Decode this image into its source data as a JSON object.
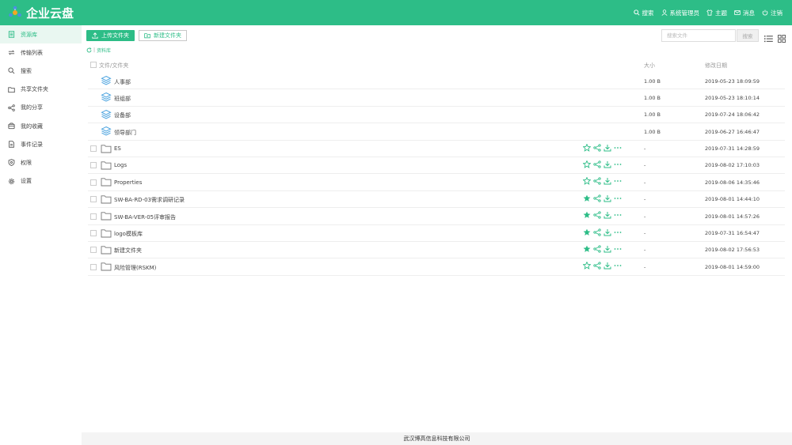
{
  "app": {
    "title": "企业云盘",
    "brand_color": "#2dbd87"
  },
  "topnav": [
    {
      "label": "搜索",
      "icon": "search-icon"
    },
    {
      "label": "系统管理员",
      "icon": "user-icon"
    },
    {
      "label": "主题",
      "icon": "shirt-icon"
    },
    {
      "label": "消息",
      "icon": "mail-icon"
    },
    {
      "label": "注销",
      "icon": "power-icon"
    }
  ],
  "sidebar": {
    "items": [
      {
        "label": "资源库",
        "icon": "library-icon",
        "active": true
      },
      {
        "label": "传输列表",
        "icon": "transfer-icon"
      },
      {
        "label": "搜索",
        "icon": "search-icon"
      },
      {
        "label": "共享文件夹",
        "icon": "folder-icon"
      },
      {
        "label": "我的分享",
        "icon": "share-icon"
      },
      {
        "label": "我的收藏",
        "icon": "collection-icon"
      },
      {
        "label": "事件记录",
        "icon": "document-icon"
      },
      {
        "label": "权限",
        "icon": "shield-icon"
      },
      {
        "label": "设置",
        "icon": "gear-icon"
      }
    ]
  },
  "toolbar": {
    "upload_label": "上传文件夹",
    "new_folder_label": "新建文件夹",
    "search_placeholder": "搜索文件",
    "search_button": "搜索"
  },
  "breadcrumb": "资料库",
  "table": {
    "headers": {
      "name": "文件/文件夹",
      "size": "大小",
      "date": "修改日期"
    },
    "rows": [
      {
        "name": "人事部",
        "type": "library",
        "size": "1.00 B",
        "date": "2019-05-23 18:09:59"
      },
      {
        "name": "班组部",
        "type": "library",
        "size": "1.00 B",
        "date": "2019-05-23 18:10:14"
      },
      {
        "name": "设备部",
        "type": "library",
        "size": "1.00 B",
        "date": "2019-07-24 18:06:42"
      },
      {
        "name": "领导部门",
        "type": "library",
        "size": "1.00 B",
        "date": "2019-06-27 16:46:47"
      },
      {
        "name": "ES",
        "type": "folder",
        "starred": false,
        "size": "-",
        "date": "2019-07-31 14:28:59"
      },
      {
        "name": "Logs",
        "type": "folder",
        "starred": false,
        "size": "-",
        "date": "2019-08-02 17:10:03"
      },
      {
        "name": "Properties",
        "type": "folder",
        "starred": false,
        "size": "-",
        "date": "2019-08-06 14:35:46"
      },
      {
        "name": "SW-BA-RD-03需求调研记录",
        "type": "folder",
        "starred": true,
        "size": "-",
        "date": "2019-08-01 14:44:10"
      },
      {
        "name": "SW-BA-VER-05评审报告",
        "type": "folder",
        "starred": true,
        "size": "-",
        "date": "2019-08-01 14:57:26"
      },
      {
        "name": "logo模板库",
        "type": "folder",
        "starred": true,
        "size": "-",
        "date": "2019-07-31 16:54:47"
      },
      {
        "name": "新建文件夹",
        "type": "folder",
        "starred": true,
        "size": "-",
        "date": "2019-08-02 17:56:53"
      },
      {
        "name": "风险管理(RSKM)",
        "type": "folder",
        "starred": false,
        "size": "-",
        "date": "2019-08-01 14:59:00"
      }
    ]
  },
  "footer": "武汉博高信息科技有限公司"
}
